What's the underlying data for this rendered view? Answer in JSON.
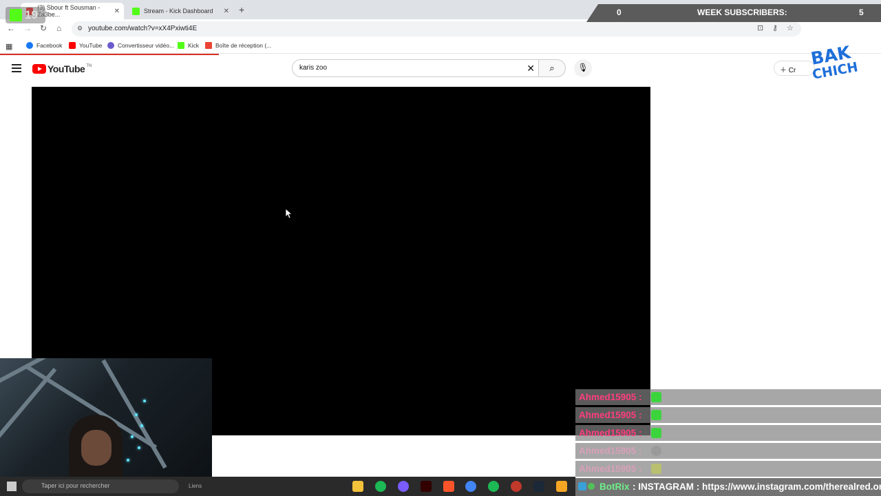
{
  "browser": {
    "tabs": [
      {
        "label": "(3) Sbour ft Sousman - Za3be...",
        "active": true
      },
      {
        "label": "Stream - Kick Dashboard",
        "active": false
      }
    ],
    "url": "youtube.com/watch?v=xX4Pxiwti4E",
    "bookmarks": [
      "Facebook",
      "YouTube",
      "Convertisseur vidéo...",
      "Kick",
      "Boîte de réception (..."
    ]
  },
  "youtube": {
    "logo": "YouTube",
    "country": "TN",
    "search_value": "karis zoo",
    "create_label": "Cr"
  },
  "overlay": {
    "sub_left_count": "0",
    "sub_title": "WEEK SUBSCRIBERS:",
    "sub_right_count": "5",
    "kick_count": "19",
    "bak": "BAK",
    "chich": "CHICH"
  },
  "chat": {
    "messages": [
      {
        "user": "Ahmed15905 :"
      },
      {
        "user": "Ahmed15905 :"
      },
      {
        "user": "Ahmed15905 :"
      },
      {
        "user": "Ahmed15905 :"
      },
      {
        "user": "Ahmed15905 :"
      }
    ],
    "bot_name": "BotRix",
    "bot_message": ": INSTAGRAM : https://www.instagram.com/therealred.on"
  },
  "taskbar": {
    "search_placeholder": "Taper ici pour rechercher",
    "label": "Liens"
  },
  "colors": {
    "accent_red": "#ff0000",
    "chat_user": "#ff3d7f",
    "bot_green": "#6ef08a",
    "kick_green": "#53fc18",
    "bakchich_blue": "#1e6fd9"
  }
}
